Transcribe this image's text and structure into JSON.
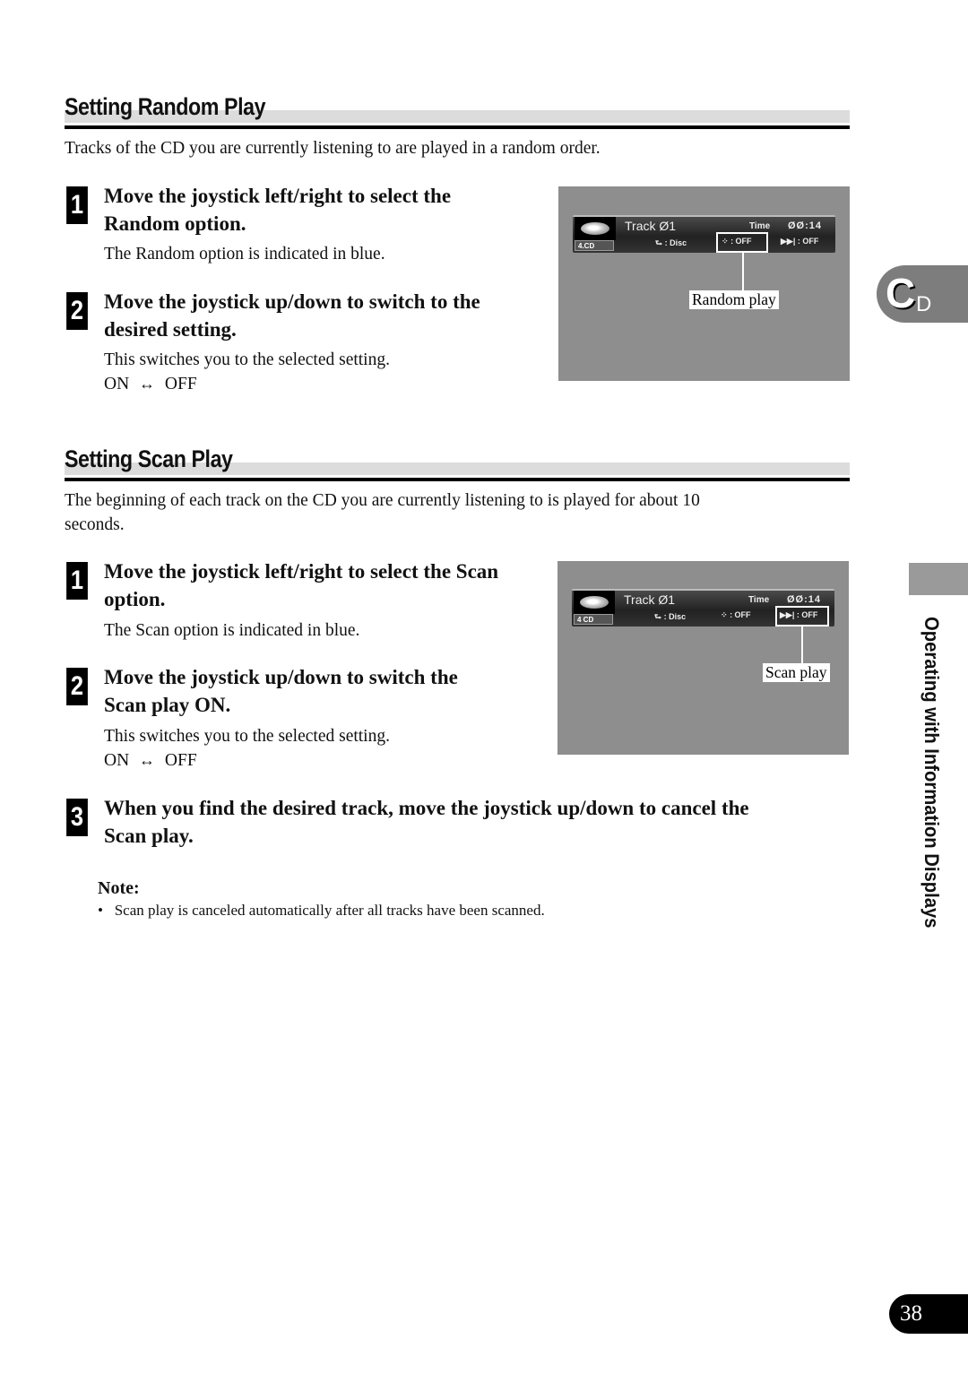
{
  "random_section": {
    "title": "Setting Random Play",
    "intro": "Tracks of the CD you are currently listening to are played in a random order.",
    "steps": [
      {
        "num": "1",
        "heading_line1": "Move the joystick left/right to select the",
        "heading_line2": "Random option.",
        "sub": "The Random option is indicated in blue."
      },
      {
        "num": "2",
        "heading_line1": "Move the joystick up/down to switch to the",
        "heading_line2": "desired setting.",
        "sub": "This switches you to the selected setting.",
        "toggle_on": "ON",
        "toggle_arrow": "↔",
        "toggle_off": "OFF"
      }
    ],
    "screen": {
      "track": "Track Ø1",
      "time_label": "Time",
      "time_value": "ØØ:14",
      "cd_label": "4.CD",
      "repeat_value": ": Disc",
      "random_value": ": OFF",
      "scan_value": ": OFF",
      "callout": "Random play"
    }
  },
  "scan_section": {
    "title": "Setting Scan Play",
    "intro_line1": "The beginning of each track on the CD you are currently listening to is played for about 10",
    "intro_line2": "seconds.",
    "steps": [
      {
        "num": "1",
        "heading_line1": "Move the joystick left/right to select the Scan",
        "heading_line2": "option.",
        "sub": "The Scan option is indicated in blue."
      },
      {
        "num": "2",
        "heading_line1": "Move the joystick up/down to switch the",
        "heading_line2": "Scan play ON.",
        "sub": "This switches you to the selected setting.",
        "toggle_on": "ON",
        "toggle_arrow": "↔",
        "toggle_off": "OFF"
      },
      {
        "num": "3",
        "heading_line1": "When you find the desired track, move the joystick up/down to cancel the",
        "heading_line2": "Scan play."
      }
    ],
    "screen": {
      "track": "Track Ø1",
      "time_label": "Time",
      "time_value": "ØØ:14",
      "cd_label": "4 CD",
      "repeat_value": ": Disc",
      "random_value": ": OFF",
      "scan_value": ": OFF",
      "callout": "Scan play"
    },
    "note_label": "Note:",
    "note_bullet": "•",
    "note_text": "Scan play is canceled automatically after all tracks have been scanned."
  },
  "side": {
    "cd_tab_big": "C",
    "cd_tab_small": "D",
    "chapter": "Operating with Information Displays"
  },
  "page_number": "38"
}
